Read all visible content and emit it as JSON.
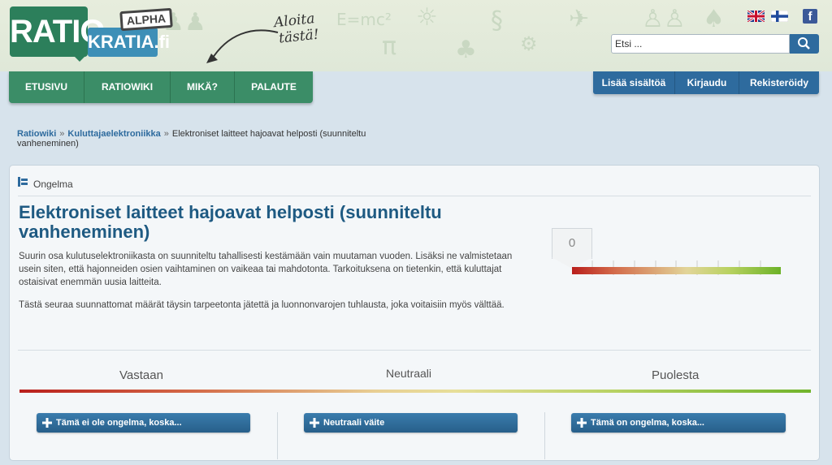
{
  "header": {
    "logo": {
      "ratio": "RATIO",
      "kratia": "KRATIA.fi",
      "alpha": "ALPHA"
    },
    "aloita_line1": "Aloita",
    "aloita_line2": "tästä!",
    "decor_text": "E=mc²",
    "flags": [
      "uk-flag-icon",
      "finland-flag-icon"
    ],
    "facebook_label": "f",
    "search": {
      "placeholder": "Etsi ...",
      "value": "Etsi ..."
    }
  },
  "main_nav": [
    {
      "label": "ETUSIVU"
    },
    {
      "label": "RATIOWIKI"
    },
    {
      "label": "MIKÄ?"
    },
    {
      "label": "PALAUTE"
    }
  ],
  "user_nav": [
    {
      "label": "Lisää sisältöä"
    },
    {
      "label": "Kirjaudu"
    },
    {
      "label": "Rekisteröidy"
    }
  ],
  "breadcrumb": {
    "items": [
      "Ratiowiki",
      "Kuluttajaelektroniikka"
    ],
    "separator": "»",
    "current": "Elektroniset laitteet hajoavat helposti (suunniteltu vanheneminen)"
  },
  "issue": {
    "type_label": "Ongelma",
    "title": "Elektroniset laitteet hajoavat helposti (suunniteltu vanheneminen)",
    "paragraphs": [
      "Suurin osa kulutuselektroniikasta on suunniteltu tahallisesti kestämään vain muutaman vuoden. Lisäksi ne valmistetaan usein siten, että hajonneiden osien vaihtaminen on vaikeaa tai mahdotonta. Tarkoituksena on tietenkin, että kuluttajat ostaisivat enemmän uusia laitteita.",
      "Tästä seuraa suunnattomat määrät täysin tarpeetonta jätettä ja luonnonvarojen tuhlausta, joka voitaisiin myös välttää."
    ],
    "score": "0"
  },
  "columns": [
    {
      "heading": "Vastaan",
      "button": "Tämä ei ole ongelma, koska..."
    },
    {
      "heading": "Neutraali",
      "button": "Neutraali väite"
    },
    {
      "heading": "Puolesta",
      "button": "Tämä on ongelma, koska..."
    }
  ],
  "colors": {
    "green_nav": "#3b8d67",
    "blue_nav": "#2e6b9e",
    "title_blue": "#1e5a82",
    "against_red": "#b91f1c",
    "for_green": "#6cb228"
  }
}
